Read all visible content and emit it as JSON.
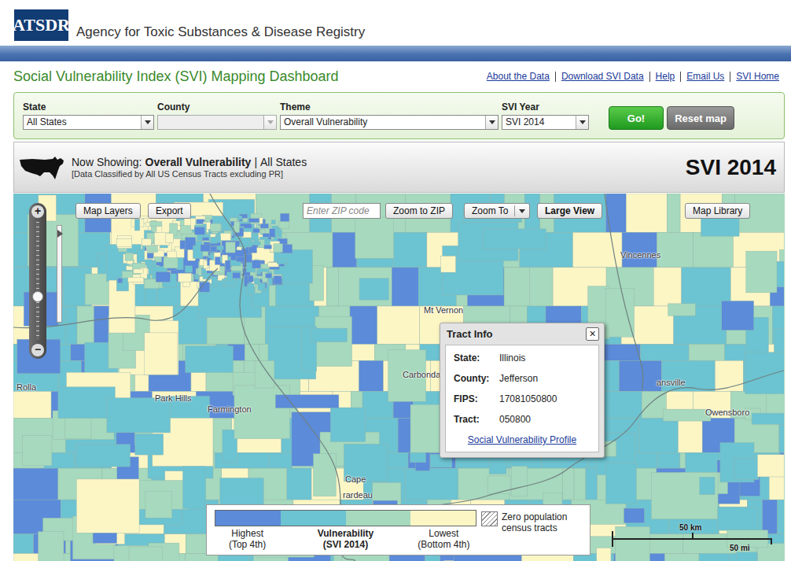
{
  "header": {
    "logo": "ATSDR",
    "agency": "Agency for Toxic Substances & Disease Registry"
  },
  "title": "Social Vulnerability Index (SVI) Mapping Dashboard",
  "links": [
    "About the Data",
    "Download SVI Data",
    "Help",
    "Email Us",
    "SVI Home"
  ],
  "filters": [
    {
      "label": "State",
      "value": "All States",
      "disabled": false
    },
    {
      "label": "County",
      "disabled": true
    },
    {
      "label": "Theme",
      "value": "Overall Vulnerability",
      "disabled": false
    },
    {
      "label": "SVI Year",
      "value": "SVI 2014",
      "disabled": false
    }
  ],
  "actions": {
    "go": "Go!",
    "reset": "Reset map"
  },
  "showing": {
    "label": "Now Showing:",
    "theme": "Overall Vulnerability",
    "separator": "|",
    "scope": "All States",
    "note": "[Data Classified by All US Census Tracts excluding PR]",
    "year": "SVI 2014"
  },
  "map": {
    "tools": {
      "layers": "Map Layers",
      "export": "Export",
      "zip_placeholder": "Enter ZIP code",
      "zoom_zip": "Zoom to ZIP",
      "zoom_to": "Zoom To",
      "large_view": "Large View",
      "library": "Map Library"
    },
    "zoom": {
      "in": "+",
      "out": "−",
      "level": 0.37
    },
    "places": [
      "Rolla",
      "Park Hills",
      "Farmington",
      "Mt Vernon",
      "Carbondale",
      "Vincennes",
      "ansville",
      "Owensboro",
      "Cape",
      "rardeau"
    ],
    "tract_info": {
      "title": "Tract Info",
      "close": "×",
      "rows": [
        {
          "label": "State:",
          "value": "Illinois"
        },
        {
          "label": "County:",
          "value": "Jefferson"
        },
        {
          "label": "FIPS:",
          "value": "17081050800"
        },
        {
          "label": "Tract:",
          "value": "050800"
        }
      ],
      "link": "Social Vulnerability Profile"
    },
    "legend": {
      "swatches": [
        {
          "color": "#5b8bd9"
        },
        {
          "color": "#6cc3d1"
        },
        {
          "color": "#a6d9bd"
        },
        {
          "color": "#fcf6c5"
        }
      ],
      "high": {
        "text": "Highest",
        "sub": "(Top 4th)"
      },
      "title": {
        "text": "Vulnerability",
        "sub": "(SVI 2014)"
      },
      "low": {
        "text": "Lowest",
        "sub": "(Bottom 4th)"
      },
      "zero": "Zero population census tracts"
    },
    "scale": {
      "km": "50 km",
      "mi": "50 mi"
    }
  }
}
